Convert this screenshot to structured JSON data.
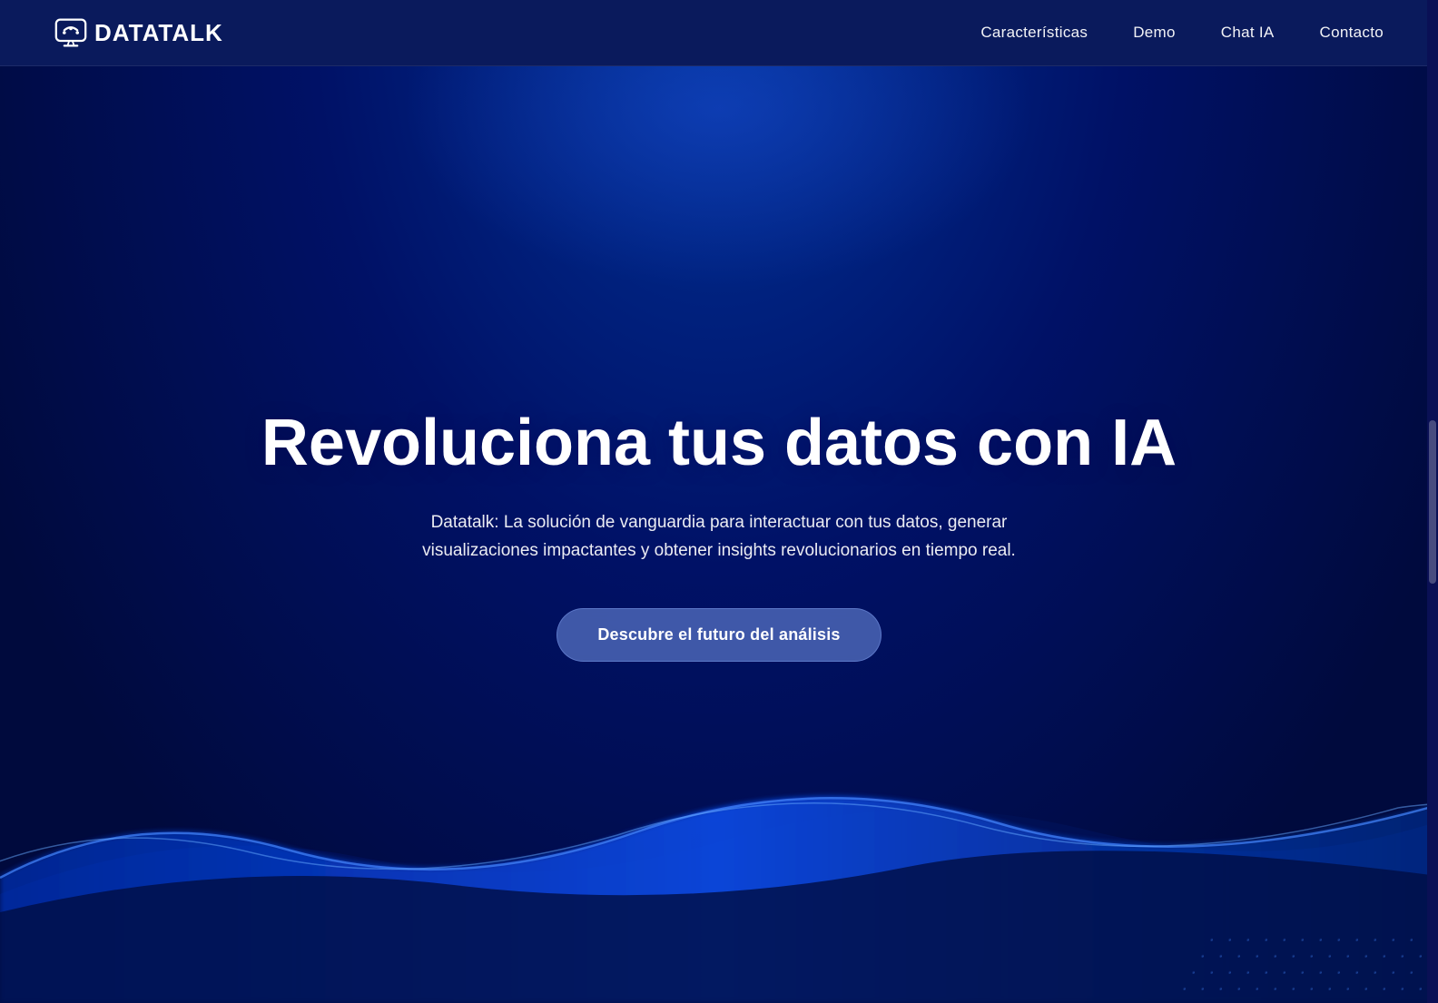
{
  "navbar": {
    "logo_text": "DATATALK",
    "nav_items": [
      {
        "label": "Características",
        "href": "#caracteristicas"
      },
      {
        "label": "Demo",
        "href": "#demo"
      },
      {
        "label": "Chat IA",
        "href": "#chat-ia"
      },
      {
        "label": "Contacto",
        "href": "#contacto"
      }
    ]
  },
  "hero": {
    "title": "Revoluciona tus datos con IA",
    "subtitle": "Datatalk: La solución de vanguardia para interactuar con tus datos, generar visualizaciones impactantes y obtener insights revolucionarios en tiempo real.",
    "cta_label": "Descubre el futuro del análisis"
  },
  "colors": {
    "nav_bg": "#0a1a5c",
    "hero_bg_start": "#003399",
    "hero_bg_end": "#000a3d",
    "wave_color": "#0055ff",
    "cta_bg": "rgba(90,120,200,0.7)",
    "text_white": "#ffffff"
  }
}
